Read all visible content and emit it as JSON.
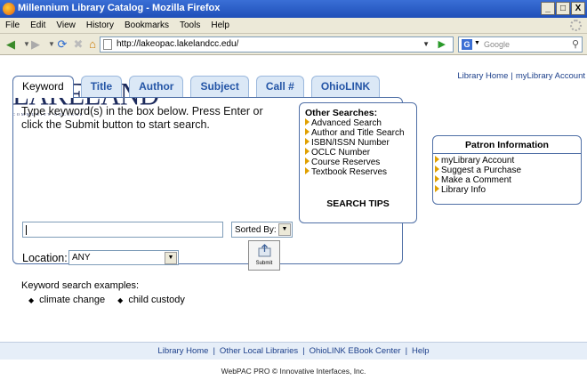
{
  "window": {
    "title": "Millennium Library Catalog - Mozilla Firefox",
    "buttons": [
      "_",
      "□",
      "X"
    ]
  },
  "menubar": {
    "items": [
      "File",
      "Edit",
      "View",
      "History",
      "Bookmarks",
      "Tools",
      "Help"
    ]
  },
  "navbar": {
    "url": "http://lakeopac.lakelandcc.edu/",
    "search_engine": "Google"
  },
  "header": {
    "logo_word": "LAKELAND",
    "logo_sub": "COMMUNITY COLLEGE",
    "links": [
      "Library Home",
      "myLibrary Account"
    ]
  },
  "tabs": [
    {
      "label": "Keyword",
      "active": true
    },
    {
      "label": "Title"
    },
    {
      "label": "Author"
    },
    {
      "label": "Subject"
    },
    {
      "label": "Call #"
    },
    {
      "label": "OhioLINK"
    }
  ],
  "search": {
    "instructions": "Type keyword(s) in the box below. Press Enter or click the Submit button to start search.",
    "keyword_value": "",
    "sort_label": "Sorted By:",
    "location_label": "Location:",
    "location_value": "ANY",
    "submit_label": "Submit",
    "examples_label": "Keyword search examples:",
    "examples": [
      "climate change",
      "child custody"
    ]
  },
  "other_searches": {
    "title": "Other Searches:",
    "items": [
      "Advanced Search",
      "Author and Title Search",
      "ISBN/ISSN Number",
      "OCLC Number",
      "Course Reserves",
      "Textbook Reserves"
    ],
    "tips": "SEARCH TIPS"
  },
  "patron": {
    "title": "Patron Information",
    "items": [
      "myLibrary Account",
      "Suggest a Purchase",
      "Make a Comment",
      "Library Info"
    ]
  },
  "footer": {
    "links": [
      "Library Home",
      "Other Local Libraries",
      "OhioLINK EBook Center",
      "Help"
    ],
    "copyright": "WebPAC PRO © Innovative Interfaces, Inc."
  }
}
